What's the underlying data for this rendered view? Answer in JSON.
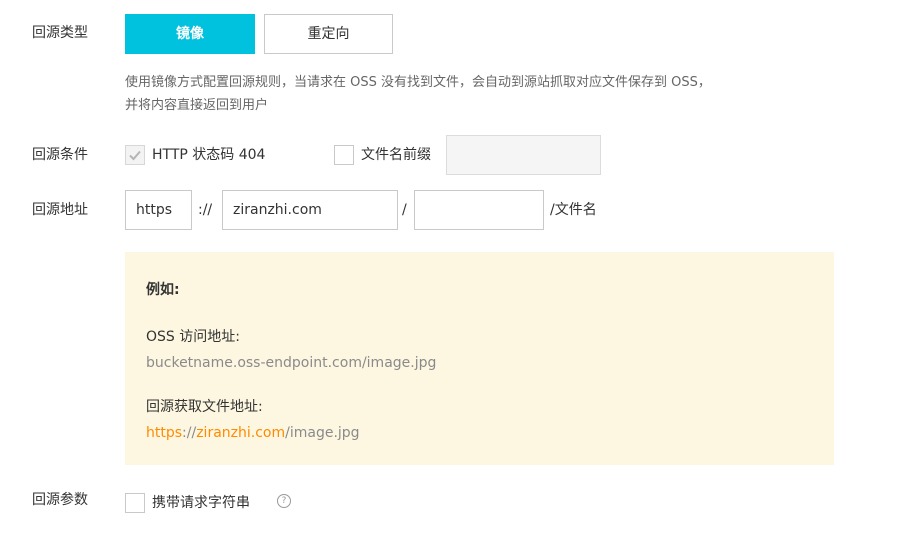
{
  "source_type": {
    "label": "回源类型",
    "mirror_button": "镜像",
    "redirect_button": "重定向",
    "description_line1": "使用镜像方式配置回源规则，当请求在 OSS 没有找到文件，会自动到源站抓取对应文件保存到 OSS，",
    "description_line2": "并将内容直接返回到用户"
  },
  "condition": {
    "label": "回源条件",
    "http_status_label": "HTTP 状态码 404",
    "prefix_label": "文件名前缀",
    "prefix_value": ""
  },
  "address": {
    "label": "回源地址",
    "protocol": "https",
    "separator": "://",
    "domain": "ziranzhi.com",
    "slash": "/",
    "path": "",
    "suffix": "/文件名"
  },
  "example": {
    "title": "例如:",
    "oss_label": "OSS 访问地址:",
    "oss_url": "bucketname.oss-endpoint.com/image.jpg",
    "fetch_label": "回源获取文件地址:",
    "fetch_protocol": "https",
    "fetch_sep": "://",
    "fetch_domain": "ziranzhi.com",
    "fetch_path": "/image.jpg"
  },
  "params": {
    "label": "回源参数",
    "query_string_label": "携带请求字符串",
    "help_icon": "?"
  },
  "colors": {
    "primary": "#00c1de",
    "highlight": "#ff8a00",
    "example_bg": "#fdf7e2"
  }
}
